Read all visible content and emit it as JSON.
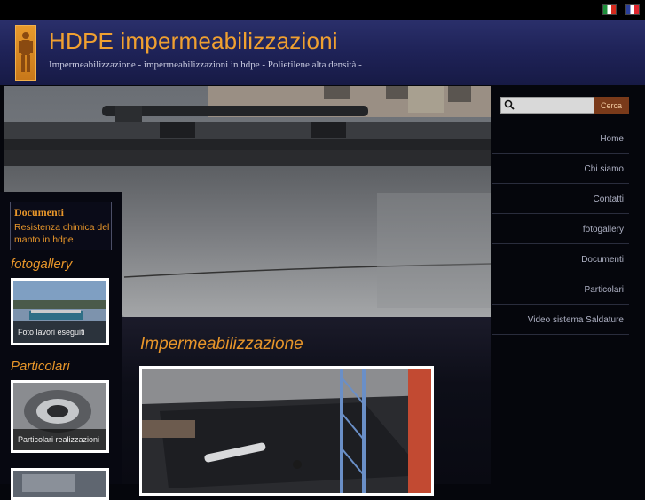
{
  "languages": [
    {
      "name": "Italiano",
      "icon": "flag-it-icon"
    },
    {
      "name": "Français",
      "icon": "flag-fr-icon"
    }
  ],
  "header": {
    "title": "HDPE impermeabilizzazioni",
    "subtitle": "Impermeabilizzazione - impermeabilizzazioni in hdpe - Polietilene alta densità -"
  },
  "sidebar": {
    "documents": {
      "title": "Documenti",
      "link": "Resistenza chimica del manto in hdpe"
    },
    "fotogallery": {
      "heading": "fotogallery",
      "caption": "Foto lavori eseguiti"
    },
    "particolari": {
      "heading": "Particolari",
      "caption": "Particolari realizzazioni"
    }
  },
  "main": {
    "heading": "Impermeabilizzazione"
  },
  "search": {
    "placeholder": "",
    "button": "Cerca"
  },
  "nav": {
    "items": [
      {
        "label": "Home"
      },
      {
        "label": "Chi siamo"
      },
      {
        "label": "Contatti"
      },
      {
        "label": "fotogallery"
      },
      {
        "label": "Documenti"
      },
      {
        "label": "Particolari"
      },
      {
        "label": "Video sistema Saldature"
      }
    ]
  },
  "colors": {
    "accent": "#e8962a",
    "header_bg": "#1e2257",
    "page_bg": "#05060c"
  }
}
